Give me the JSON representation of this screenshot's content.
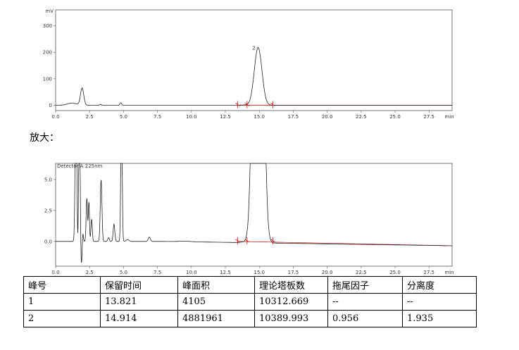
{
  "zoom_label": "放大：",
  "colors": {
    "trace": "#222222",
    "baseline": "#cc0000",
    "axis": "#555555"
  },
  "chart_data": [
    {
      "type": "line",
      "ylabel": "mV",
      "xlabel": "min",
      "xlim": [
        0,
        29.2
      ],
      "ylim": [
        -20,
        360
      ],
      "xticks": [
        0.0,
        2.5,
        5.0,
        7.5,
        10.0,
        12.5,
        15.0,
        17.5,
        20.0,
        22.5,
        25.0,
        27.5
      ],
      "xtick_labels": [
        "0.0",
        "2.5",
        "5.0",
        "7.5",
        "10.0",
        "12.5",
        "15.0",
        "17.5",
        "20.0",
        "22.5",
        "25.0",
        "27.5"
      ],
      "yticks": [
        0,
        100,
        200,
        300
      ],
      "ytick_labels": [
        "0",
        "100",
        "200",
        "300"
      ],
      "peaks": [
        {
          "rt": 1.2,
          "height": 8,
          "width": 0.35
        },
        {
          "rt": 1.95,
          "height": 65,
          "width": 0.12
        },
        {
          "rt": 3.3,
          "height": 4,
          "width": 0.06
        },
        {
          "rt": 4.8,
          "height": 10,
          "width": 0.06
        },
        {
          "rt": 13.821,
          "height": 1,
          "width": 0.2
        },
        {
          "rt": 14.914,
          "height": 218,
          "width": 0.28
        }
      ],
      "peak_label": "2",
      "markers": [
        13.4,
        14.1,
        16.0
      ],
      "grid": false
    },
    {
      "type": "line",
      "title": "Detector A 225nm",
      "xlabel": "min",
      "xlim": [
        0,
        29.2
      ],
      "ylim": [
        -2.0,
        6.3
      ],
      "xticks": [
        0.0,
        2.5,
        5.0,
        7.5,
        10.0,
        12.5,
        15.0,
        17.5,
        20.0,
        22.5,
        25.0,
        27.5
      ],
      "xtick_labels": [
        "0.0",
        "2.5",
        "5.0",
        "7.5",
        "10.0",
        "12.5",
        "15.0",
        "17.5",
        "20.0",
        "22.5",
        "25.0",
        "27.5"
      ],
      "yticks": [
        0.0,
        2.5,
        5.0
      ],
      "ytick_labels": [
        "0.0",
        "2.5",
        "5.0"
      ],
      "peaks": [
        {
          "rt": 1.5,
          "height": 12,
          "width": 0.06
        },
        {
          "rt": 1.75,
          "height": 12,
          "width": 0.05
        },
        {
          "rt": 2.0,
          "height": 0.8,
          "width": 0.04
        },
        {
          "rt": 2.3,
          "height": 3.5,
          "width": 0.05
        },
        {
          "rt": 2.45,
          "height": 3.2,
          "width": 0.04
        },
        {
          "rt": 2.65,
          "height": 1.8,
          "width": 0.05
        },
        {
          "rt": 3.35,
          "height": 5.0,
          "width": 0.06
        },
        {
          "rt": 3.9,
          "height": 0.3,
          "width": 0.06
        },
        {
          "rt": 4.3,
          "height": 1.4,
          "width": 0.06
        },
        {
          "rt": 4.85,
          "height": 12,
          "width": 0.05
        },
        {
          "rt": 5.3,
          "height": 0.15,
          "width": 0.1
        },
        {
          "rt": 6.9,
          "height": 0.35,
          "width": 0.08
        },
        {
          "rt": 9.5,
          "height": 0.05,
          "width": 0.4
        },
        {
          "rt": 13.821,
          "height": 0.05,
          "width": 0.2
        },
        {
          "rt": 14.914,
          "height": 60,
          "width": 0.28
        }
      ],
      "dips": [
        {
          "rt": 1.62,
          "depth": -1.2,
          "width": 0.04
        },
        {
          "rt": 1.9,
          "depth": -1.9,
          "width": 0.05
        }
      ],
      "markers": [
        13.4,
        14.1,
        16.0
      ],
      "grid": false
    }
  ],
  "table": {
    "headers": [
      "峰号",
      "保留时间",
      "峰面积",
      "理论塔板数",
      "拖尾因子",
      "分离度"
    ],
    "rows": [
      [
        "1",
        "13.821",
        "4105",
        "10312.669",
        "--",
        "--"
      ],
      [
        "2",
        "14.914",
        "4881961",
        "10389.993",
        "0.956",
        "1.935"
      ]
    ]
  }
}
